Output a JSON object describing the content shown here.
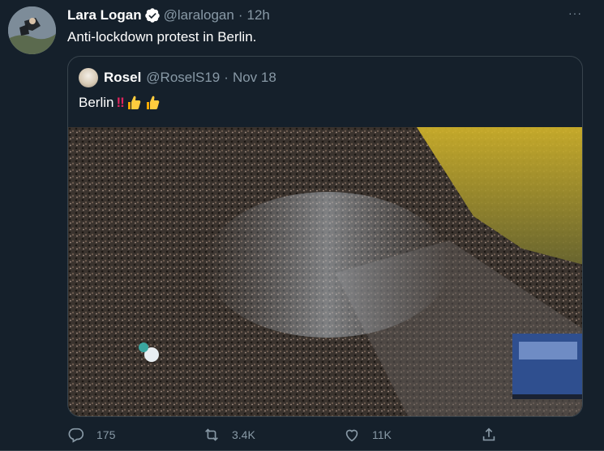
{
  "tweet": {
    "author_name": "Lara Logan",
    "handle": "@laralogan",
    "time": "12h",
    "text": "Anti-lockdown protest in Berlin.",
    "more": "···"
  },
  "quoted": {
    "author_name": "Rosel",
    "handle": "@RoselS19",
    "date": "Nov 18",
    "text": "Berlin",
    "emphasis": "‼"
  },
  "actions": {
    "replies": "175",
    "retweets": "3.4K",
    "likes": "11K"
  },
  "colors": {
    "background": "#15202b",
    "muted": "#8899a6",
    "border": "#38444d",
    "verified": "#ffffff"
  },
  "icons": [
    "verified-icon",
    "more-icon",
    "reply-icon",
    "retweet-icon",
    "like-icon",
    "share-icon",
    "thumbs-up-icon"
  ]
}
